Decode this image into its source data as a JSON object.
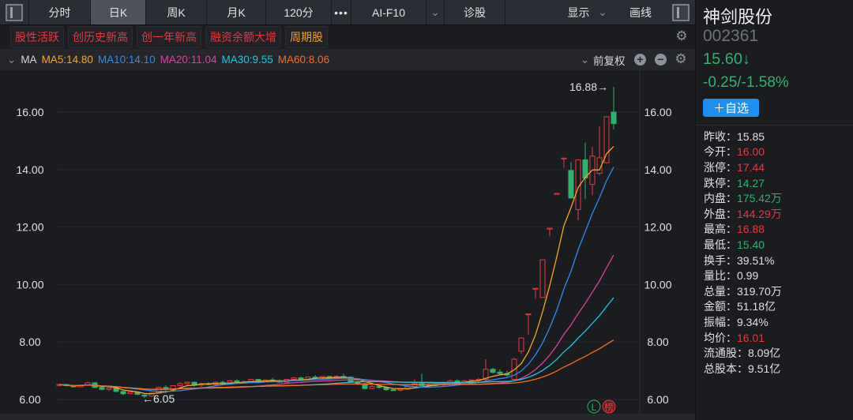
{
  "toolbar": {
    "tabs": [
      "分时",
      "日K",
      "周K",
      "月K",
      "120分",
      "•••",
      "AI-F10",
      "诊股"
    ],
    "active": "日K",
    "ai_chevron": "⌄",
    "display": "显示",
    "display_chevron": "⌄",
    "draw": "画线"
  },
  "tags": [
    {
      "label": "股性活跃",
      "color": "#e8383d"
    },
    {
      "label": "创历史新高",
      "color": "#e8383d"
    },
    {
      "label": "创一年新高",
      "color": "#e8383d"
    },
    {
      "label": "融资余额大增",
      "color": "#e8383d"
    },
    {
      "label": "周期股",
      "color": "#f5a020"
    }
  ],
  "ma": {
    "toggle": "⌄",
    "label": "MA",
    "items": [
      {
        "text": "MA5:14.80",
        "color": "#f5a623"
      },
      {
        "text": "MA10:14.10",
        "color": "#2d8cf0"
      },
      {
        "text": "MA20:11.04",
        "color": "#e040a0"
      },
      {
        "text": "MA30:9.55",
        "color": "#1ec8e0"
      },
      {
        "text": "MA60:8.06",
        "color": "#ff6a1a"
      }
    ],
    "adjust": "前复权",
    "adjust_chevron": "⌄"
  },
  "stock": {
    "name": "神剑股份",
    "code": "002361",
    "price": "15.60↓",
    "change": "-0.25/-1.58%",
    "add_label": "＋自选"
  },
  "stats": [
    {
      "label": "昨收：",
      "value": "15.85",
      "color": "white"
    },
    {
      "label": "今开：",
      "value": "16.00",
      "color": "red"
    },
    {
      "label": "涨停：",
      "value": "17.44",
      "color": "red"
    },
    {
      "label": "跌停：",
      "value": "14.27",
      "color": "green"
    },
    {
      "label": "内盘：",
      "value": "175.42万",
      "color": "green"
    },
    {
      "label": "外盘：",
      "value": "144.29万",
      "color": "red"
    },
    {
      "label": "最高：",
      "value": "16.88",
      "color": "red"
    },
    {
      "label": "最低：",
      "value": "15.40",
      "color": "green"
    },
    {
      "label": "换手：",
      "value": "39.51%",
      "color": "white"
    },
    {
      "label": "量比：",
      "value": "0.99",
      "color": "white"
    },
    {
      "label": "总量：",
      "value": "319.70万",
      "color": "white"
    },
    {
      "label": "金额：",
      "value": "51.18亿",
      "color": "white"
    },
    {
      "label": "振幅：",
      "value": "9.34%",
      "color": "white"
    },
    {
      "label": "均价：",
      "value": "16.01",
      "color": "red"
    },
    {
      "label": "流通股：",
      "value": "8.09亿",
      "color": "white"
    },
    {
      "label": "总股本：",
      "value": "9.51亿",
      "color": "white"
    }
  ],
  "chart_data": {
    "type": "candlestick",
    "y_ticks": [
      "6.00",
      "8.00",
      "10.00",
      "12.00",
      "14.00",
      "16.00"
    ],
    "ylim": [
      6,
      16
    ],
    "colors": {
      "up": "#e8383d",
      "down": "#2db36b"
    },
    "high_label": "16.88→",
    "low_label": "←6.05",
    "badges": [
      "L",
      "榜"
    ],
    "ma_periods": [
      5,
      10,
      20,
      30,
      60
    ],
    "ohlc": [
      [
        6.5,
        6.55,
        6.45,
        6.52
      ],
      [
        6.52,
        6.55,
        6.46,
        6.48
      ],
      [
        6.48,
        6.5,
        6.42,
        6.44
      ],
      [
        6.44,
        6.52,
        6.43,
        6.5
      ],
      [
        6.5,
        6.62,
        6.48,
        6.58
      ],
      [
        6.58,
        6.6,
        6.4,
        6.42
      ],
      [
        6.42,
        6.45,
        6.32,
        6.35
      ],
      [
        6.35,
        6.42,
        6.3,
        6.4
      ],
      [
        6.4,
        6.42,
        6.25,
        6.28
      ],
      [
        6.28,
        6.3,
        6.15,
        6.2
      ],
      [
        6.2,
        6.3,
        6.18,
        6.26
      ],
      [
        6.26,
        6.28,
        6.15,
        6.18
      ],
      [
        6.15,
        6.2,
        6.05,
        6.12
      ],
      [
        6.12,
        6.25,
        6.1,
        6.22
      ],
      [
        6.22,
        6.45,
        6.2,
        6.42
      ],
      [
        6.42,
        6.5,
        6.3,
        6.35
      ],
      [
        6.35,
        6.5,
        6.33,
        6.48
      ],
      [
        6.48,
        6.6,
        6.45,
        6.55
      ],
      [
        6.55,
        6.62,
        6.5,
        6.6
      ],
      [
        6.6,
        6.62,
        6.45,
        6.5
      ],
      [
        6.5,
        6.58,
        6.44,
        6.55
      ],
      [
        6.55,
        6.6,
        6.5,
        6.52
      ],
      [
        6.52,
        6.62,
        6.5,
        6.6
      ],
      [
        6.6,
        6.65,
        6.52,
        6.55
      ],
      [
        6.55,
        6.68,
        6.55,
        6.65
      ],
      [
        6.65,
        6.7,
        6.55,
        6.58
      ],
      [
        6.58,
        6.66,
        6.55,
        6.62
      ],
      [
        6.62,
        6.72,
        6.6,
        6.7
      ],
      [
        6.7,
        6.72,
        6.6,
        6.62
      ],
      [
        6.62,
        6.7,
        6.6,
        6.68
      ],
      [
        6.68,
        6.75,
        6.62,
        6.65
      ],
      [
        6.65,
        6.7,
        6.58,
        6.6
      ],
      [
        6.6,
        6.72,
        6.58,
        6.7
      ],
      [
        6.7,
        6.78,
        6.65,
        6.75
      ],
      [
        6.75,
        6.8,
        6.65,
        6.68
      ],
      [
        6.68,
        6.8,
        6.66,
        6.78
      ],
      [
        6.78,
        6.85,
        6.7,
        6.75
      ],
      [
        6.75,
        6.82,
        6.7,
        6.8
      ],
      [
        6.8,
        6.82,
        6.72,
        6.74
      ],
      [
        6.74,
        6.85,
        6.72,
        6.8
      ],
      [
        6.8,
        6.9,
        6.75,
        6.78
      ],
      [
        6.78,
        6.8,
        6.6,
        6.62
      ],
      [
        6.62,
        6.65,
        6.5,
        6.55
      ],
      [
        6.55,
        6.58,
        6.35,
        6.38
      ],
      [
        6.38,
        6.5,
        6.35,
        6.45
      ],
      [
        6.45,
        6.5,
        6.38,
        6.42
      ],
      [
        6.42,
        6.45,
        6.3,
        6.34
      ],
      [
        6.34,
        6.4,
        6.3,
        6.32
      ],
      [
        6.32,
        6.38,
        6.28,
        6.36
      ],
      [
        6.36,
        6.5,
        6.34,
        6.45
      ],
      [
        6.45,
        6.7,
        6.42,
        6.55
      ],
      [
        6.55,
        6.9,
        6.45,
        6.48
      ],
      [
        6.48,
        6.55,
        6.44,
        6.52
      ],
      [
        6.52,
        6.6,
        6.45,
        6.5
      ],
      [
        6.5,
        6.62,
        6.48,
        6.58
      ],
      [
        6.58,
        6.7,
        6.55,
        6.65
      ],
      [
        6.65,
        6.7,
        6.55,
        6.6
      ],
      [
        6.6,
        6.68,
        6.55,
        6.65
      ],
      [
        6.65,
        6.7,
        6.55,
        6.68
      ],
      [
        6.68,
        6.75,
        6.6,
        6.7
      ],
      [
        6.7,
        7.4,
        6.6,
        7.05
      ],
      [
        7.05,
        7.1,
        6.9,
        6.95
      ],
      [
        6.95,
        7.05,
        6.85,
        6.9
      ],
      [
        6.9,
        7.0,
        6.8,
        6.85
      ],
      [
        6.7,
        7.45,
        6.62,
        7.4
      ],
      [
        7.68,
        8.14,
        7.6,
        8.14
      ],
      [
        8.98,
        8.98,
        8.25,
        8.98
      ],
      [
        9.87,
        9.87,
        9.49,
        9.87
      ],
      [
        9.55,
        10.86,
        9.55,
        10.86
      ],
      [
        11.96,
        11.96,
        11.69,
        11.96
      ],
      [
        13.17,
        13.17,
        13.17,
        13.17
      ],
      [
        14.4,
        14.4,
        14.06,
        14.4
      ],
      [
        13.97,
        14.26,
        13.01,
        13.01
      ],
      [
        12.61,
        14.34,
        12.24,
        14.34
      ],
      [
        14.34,
        14.94,
        12.97,
        13.71
      ],
      [
        13.48,
        14.79,
        13.11,
        14.47
      ],
      [
        13.87,
        15.5,
        13.8,
        14.41
      ],
      [
        14.24,
        15.84,
        14.21,
        15.84
      ],
      [
        16.0,
        16.88,
        15.4,
        15.6
      ]
    ]
  }
}
